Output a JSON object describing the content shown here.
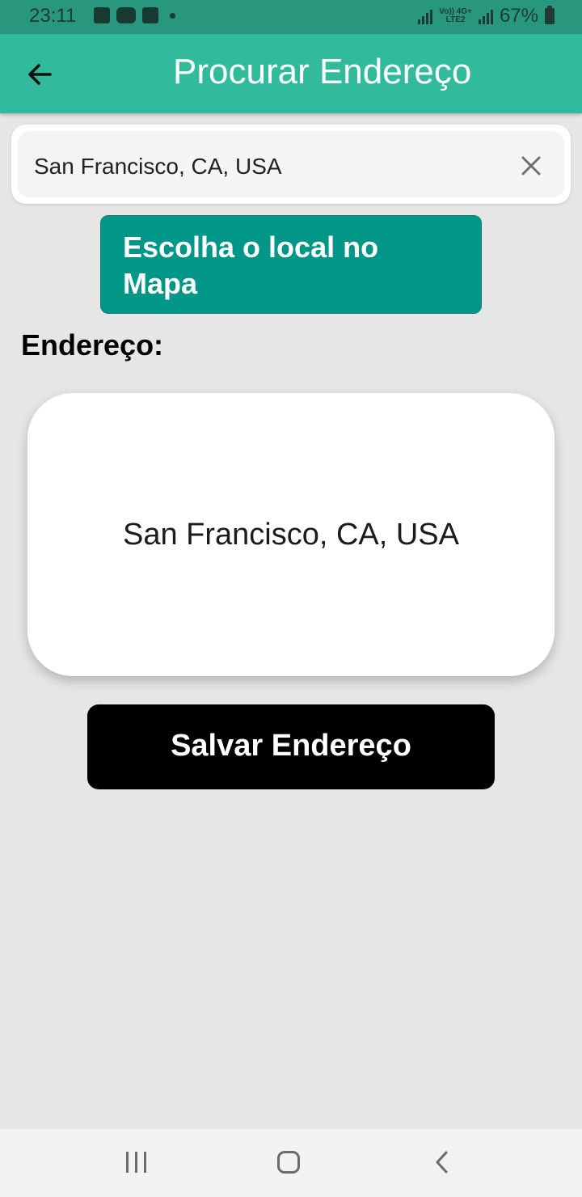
{
  "status_bar": {
    "time": "23:11",
    "network_top": "Vo)) 4G+",
    "network_bottom": "LTE2",
    "battery": "67%"
  },
  "app_bar": {
    "title": "Procurar Endereço",
    "back_icon": "arrow-left-icon"
  },
  "search": {
    "value": "San Francisco, CA, USA",
    "clear_icon": "close-icon"
  },
  "map_button": {
    "label": "Escolha o local no Mapa"
  },
  "address": {
    "label": "Endereço:",
    "value": "San Francisco, CA, USA"
  },
  "save_button": {
    "label": "Salvar Endereço"
  },
  "nav_bar": {
    "recents_icon": "recents-icon",
    "home_icon": "home-icon",
    "back_icon": "back-chevron-icon"
  },
  "colors": {
    "status_bar": "#29977e",
    "app_bar": "#31ba9b",
    "map_button": "#009688",
    "save_button": "#000000",
    "background": "#e6e6e6"
  }
}
